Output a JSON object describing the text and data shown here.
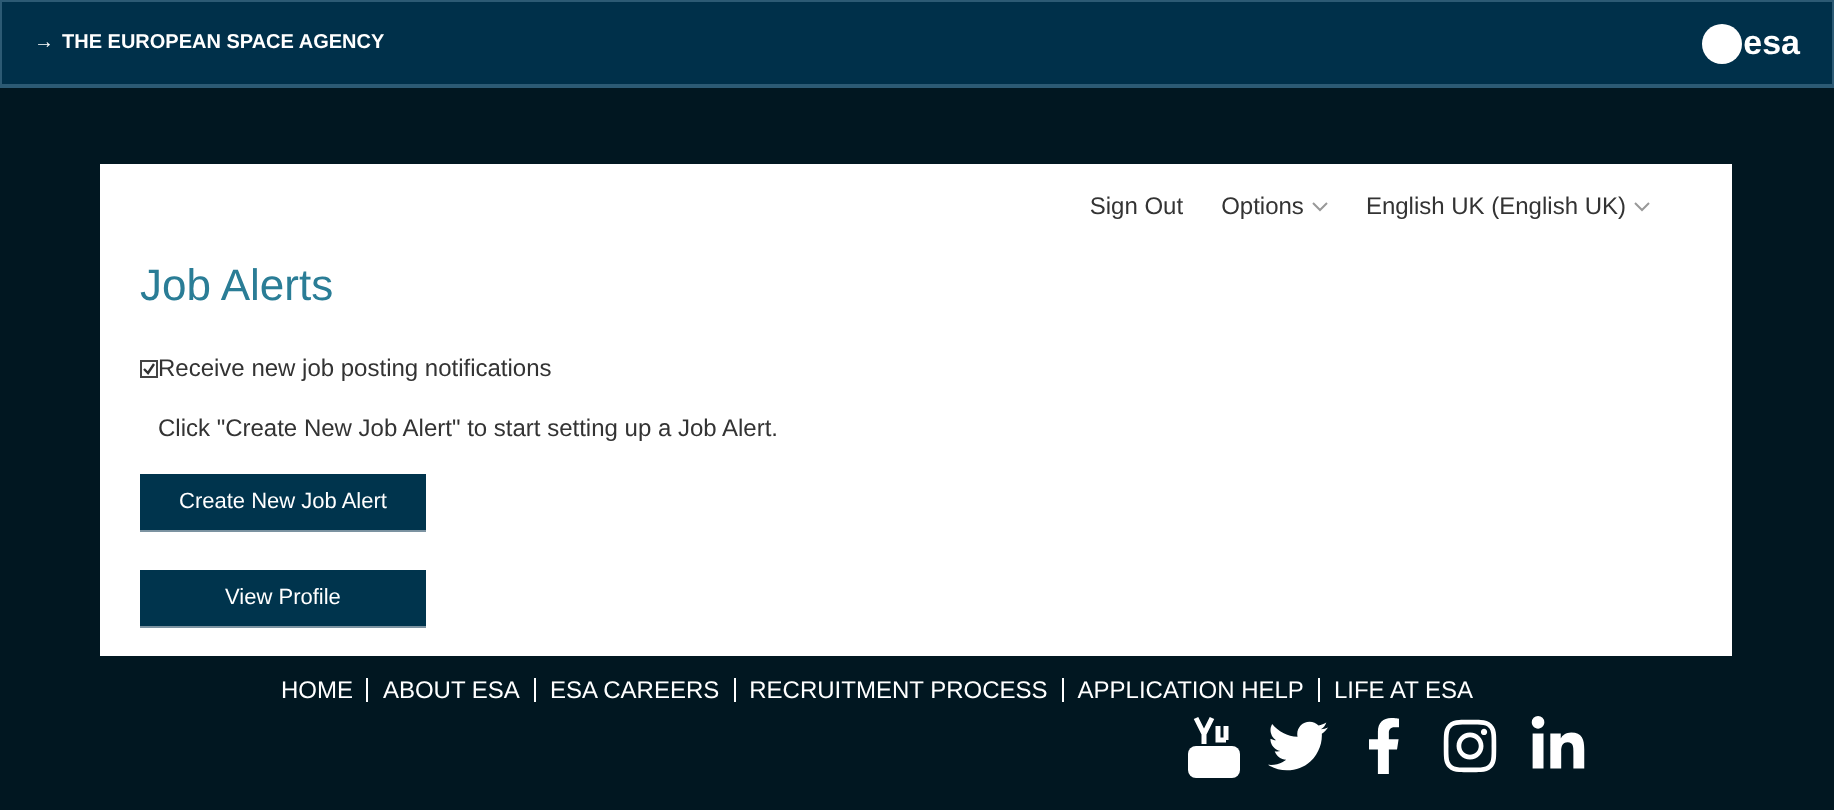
{
  "header": {
    "arrow": "→",
    "title": "THE EUROPEAN SPACE AGENCY",
    "logo_text": "esa"
  },
  "top_links": [
    {
      "label": "Sign Out",
      "dropdown": false
    },
    {
      "label": "Options",
      "dropdown": true
    },
    {
      "label": "English UK (English UK)",
      "dropdown": true
    }
  ],
  "page_title": "Job Alerts",
  "notifications_checkbox": {
    "label": "Receive new job posting notifications",
    "checked": true
  },
  "instruction": "Click \"Create New Job Alert\" to start setting up a Job Alert.",
  "buttons": [
    "Create New Job Alert",
    "View Profile"
  ],
  "footer_links": [
    "HOME",
    "ABOUT ESA",
    "ESA CAREERS",
    "RECRUITMENT PROCESS",
    "APPLICATION HELP",
    "LIFE AT ESA"
  ],
  "social": [
    {
      "kind": "youtube"
    },
    {
      "kind": "twitter"
    },
    {
      "kind": "facebook"
    },
    {
      "kind": "instagram"
    },
    {
      "kind": "linkedin"
    }
  ]
}
